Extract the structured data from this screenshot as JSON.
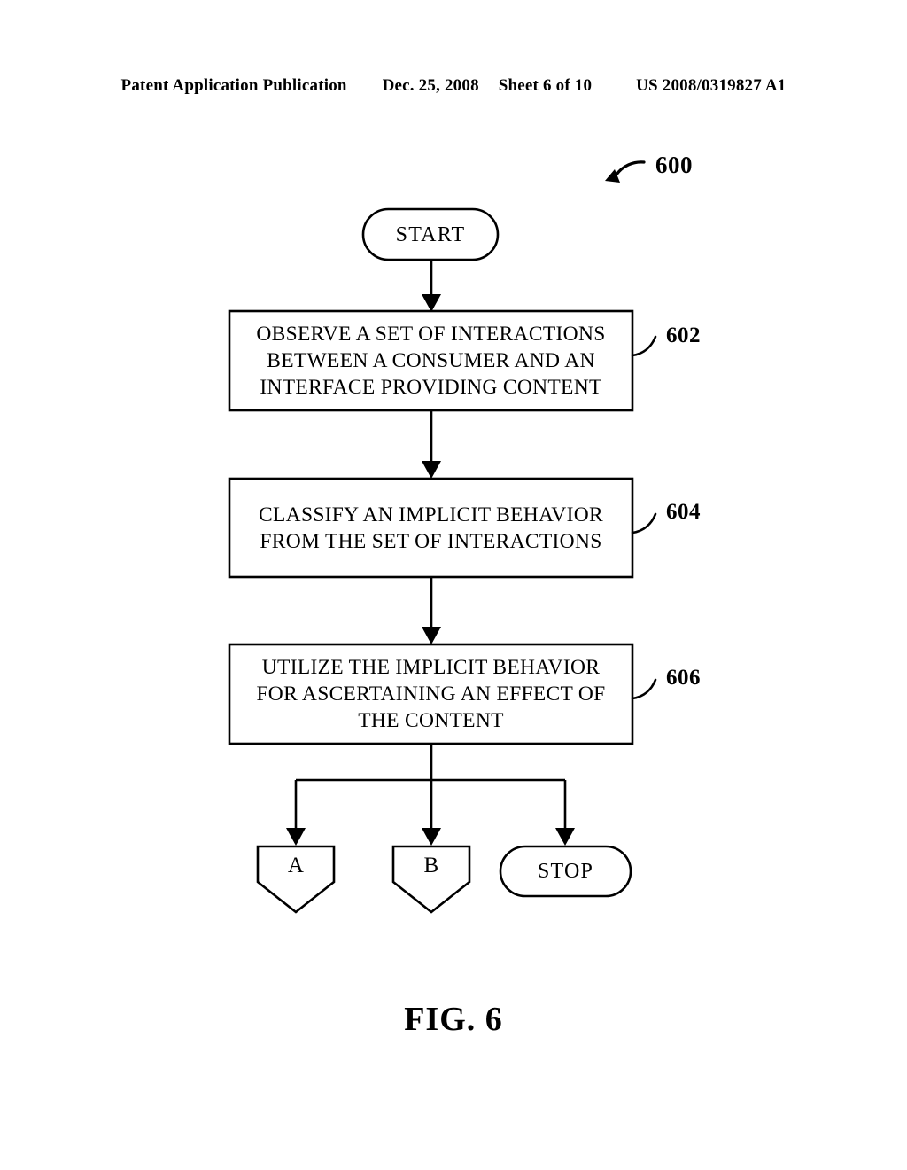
{
  "header": {
    "publication": "Patent Application Publication",
    "date": "Dec. 25, 2008",
    "sheet": "Sheet 6 of 10",
    "patent_number": "US 2008/0319827 A1"
  },
  "figure": {
    "caption": "FIG. 6",
    "diagram_number": "600"
  },
  "flowchart": {
    "type": "process-flow",
    "nodes": [
      {
        "id": "start",
        "shape": "stadium",
        "label": "START",
        "lines": [
          "START"
        ],
        "ref": null
      },
      {
        "id": "step-602",
        "shape": "rectangle",
        "label": "OBSERVE A SET OF INTERACTIONS BETWEEN A CONSUMER AND AN INTERFACE PROVIDING CONTENT",
        "lines": [
          "OBSERVE A SET OF INTERACTIONS",
          "BETWEEN A CONSUMER AND AN",
          "INTERFACE PROVIDING CONTENT"
        ],
        "ref": "602"
      },
      {
        "id": "step-604",
        "shape": "rectangle",
        "label": "CLASSIFY AN IMPLICIT BEHAVIOR FROM THE SET OF INTERACTIONS",
        "lines": [
          "CLASSIFY AN IMPLICIT BEHAVIOR",
          "FROM THE SET OF INTERACTIONS"
        ],
        "ref": "604"
      },
      {
        "id": "step-606",
        "shape": "rectangle",
        "label": "UTILIZE THE IMPLICIT BEHAVIOR FOR ASCERTAINING AN EFFECT OF THE CONTENT",
        "lines": [
          "UTILIZE THE IMPLICIT BEHAVIOR",
          "FOR ASCERTAINING AN EFFECT OF",
          "THE CONTENT"
        ],
        "ref": "606"
      },
      {
        "id": "connector-a",
        "shape": "pentagon",
        "label": "A",
        "lines": [
          "A"
        ],
        "ref": null
      },
      {
        "id": "connector-b",
        "shape": "pentagon",
        "label": "B",
        "lines": [
          "B"
        ],
        "ref": null
      },
      {
        "id": "stop",
        "shape": "stadium",
        "label": "STOP",
        "lines": [
          "STOP"
        ],
        "ref": null
      }
    ],
    "edges": [
      {
        "from": "start",
        "to": "step-602",
        "style": "arrow"
      },
      {
        "from": "step-602",
        "to": "step-604",
        "style": "arrow"
      },
      {
        "from": "step-604",
        "to": "step-606",
        "style": "arrow"
      },
      {
        "from": "step-606",
        "to": "connector-a",
        "style": "arrow-branch"
      },
      {
        "from": "step-606",
        "to": "connector-b",
        "style": "arrow-branch"
      },
      {
        "from": "step-606",
        "to": "stop",
        "style": "arrow-branch"
      }
    ]
  },
  "colors": {
    "line": "#000000",
    "fill": "#ffffff",
    "text": "#000000"
  }
}
